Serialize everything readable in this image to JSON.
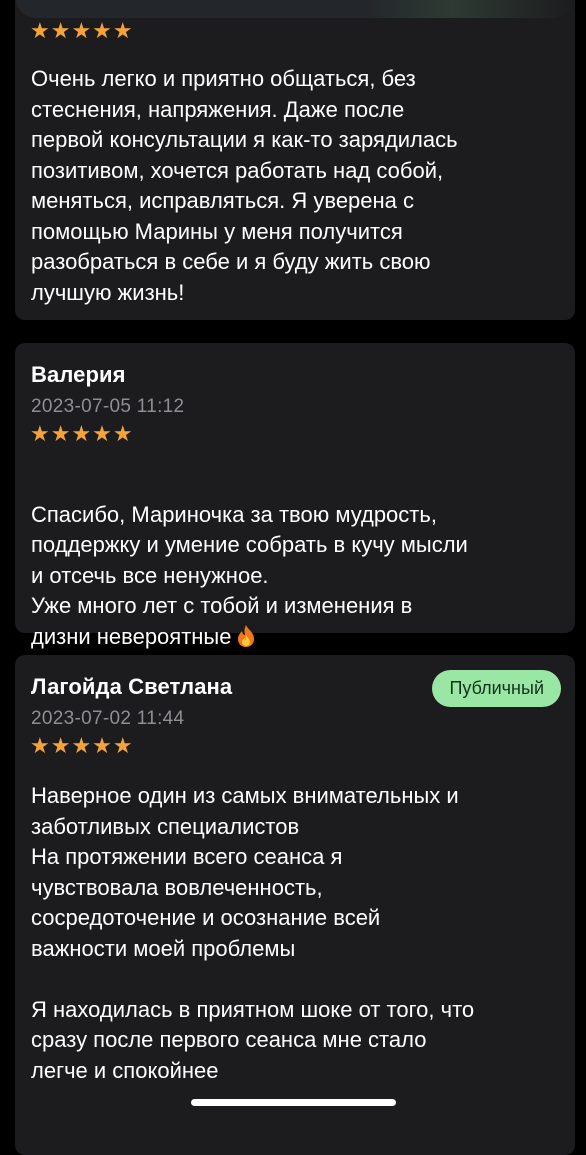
{
  "colors": {
    "background": "#000000",
    "card": "#1c1c1e",
    "star": "#f4a33a",
    "date": "#8e8e93",
    "badge_bg": "#9ae6a4",
    "badge_text": "#12331c"
  },
  "reviews": [
    {
      "rating": 5,
      "stars": "★★★★★",
      "text": "Очень легко и приятно общаться, без\nстеснения, напряжения. Даже после\nпервой консультации я как-то зарядилась\nпозитивом, хочется работать над собой,\nменяться, исправляться. Я уверена с\nпомощью Марины у меня получится\nразобраться в себе и я буду жить свою\nлучшую жизнь!"
    },
    {
      "author": "Валерия",
      "date": "2023-07-05 11:12",
      "rating": 5,
      "stars": "★★★★★",
      "text": "Спасибо, Мариночка за твою мудрость,\nподдержку и умение собрать в кучу мысли\nи отсечь все ненужное.\nУже много лет с тобой и изменения в\nдизни невероятные",
      "emoji_icon": "fire-icon"
    },
    {
      "author": "Лагойда Светлана",
      "date": "2023-07-02 11:44",
      "badge": "Публичный",
      "rating": 5,
      "stars": "★★★★★",
      "text": "Наверное один из самых внимательных и\nзаботливых специалистов\nНа протяжении всего сеанса я\nчувствовала вовлеченность,\nсосредоточение и осознание всей\nважности моей проблемы\n\nЯ находилась в приятном шоке от того, что\nсразу после первого сеанса мне стало\nлегче и спокойнее"
    }
  ]
}
